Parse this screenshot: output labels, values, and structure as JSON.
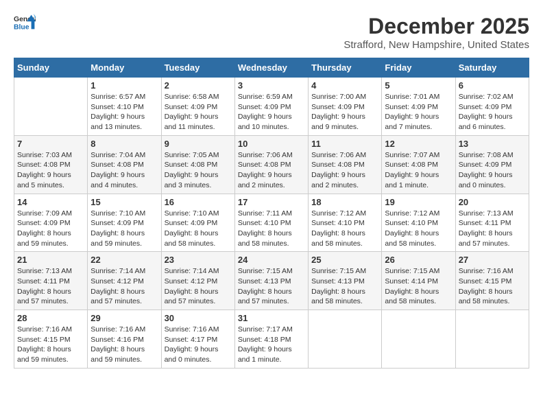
{
  "logo": {
    "line1": "General",
    "line2": "Blue"
  },
  "title": "December 2025",
  "location": "Strafford, New Hampshire, United States",
  "days_of_week": [
    "Sunday",
    "Monday",
    "Tuesday",
    "Wednesday",
    "Thursday",
    "Friday",
    "Saturday"
  ],
  "weeks": [
    [
      {
        "day": "",
        "info": ""
      },
      {
        "day": "1",
        "info": "Sunrise: 6:57 AM\nSunset: 4:10 PM\nDaylight: 9 hours\nand 13 minutes."
      },
      {
        "day": "2",
        "info": "Sunrise: 6:58 AM\nSunset: 4:09 PM\nDaylight: 9 hours\nand 11 minutes."
      },
      {
        "day": "3",
        "info": "Sunrise: 6:59 AM\nSunset: 4:09 PM\nDaylight: 9 hours\nand 10 minutes."
      },
      {
        "day": "4",
        "info": "Sunrise: 7:00 AM\nSunset: 4:09 PM\nDaylight: 9 hours\nand 9 minutes."
      },
      {
        "day": "5",
        "info": "Sunrise: 7:01 AM\nSunset: 4:09 PM\nDaylight: 9 hours\nand 7 minutes."
      },
      {
        "day": "6",
        "info": "Sunrise: 7:02 AM\nSunset: 4:09 PM\nDaylight: 9 hours\nand 6 minutes."
      }
    ],
    [
      {
        "day": "7",
        "info": "Sunrise: 7:03 AM\nSunset: 4:08 PM\nDaylight: 9 hours\nand 5 minutes."
      },
      {
        "day": "8",
        "info": "Sunrise: 7:04 AM\nSunset: 4:08 PM\nDaylight: 9 hours\nand 4 minutes."
      },
      {
        "day": "9",
        "info": "Sunrise: 7:05 AM\nSunset: 4:08 PM\nDaylight: 9 hours\nand 3 minutes."
      },
      {
        "day": "10",
        "info": "Sunrise: 7:06 AM\nSunset: 4:08 PM\nDaylight: 9 hours\nand 2 minutes."
      },
      {
        "day": "11",
        "info": "Sunrise: 7:06 AM\nSunset: 4:08 PM\nDaylight: 9 hours\nand 2 minutes."
      },
      {
        "day": "12",
        "info": "Sunrise: 7:07 AM\nSunset: 4:08 PM\nDaylight: 9 hours\nand 1 minute."
      },
      {
        "day": "13",
        "info": "Sunrise: 7:08 AM\nSunset: 4:09 PM\nDaylight: 9 hours\nand 0 minutes."
      }
    ],
    [
      {
        "day": "14",
        "info": "Sunrise: 7:09 AM\nSunset: 4:09 PM\nDaylight: 8 hours\nand 59 minutes."
      },
      {
        "day": "15",
        "info": "Sunrise: 7:10 AM\nSunset: 4:09 PM\nDaylight: 8 hours\nand 59 minutes."
      },
      {
        "day": "16",
        "info": "Sunrise: 7:10 AM\nSunset: 4:09 PM\nDaylight: 8 hours\nand 58 minutes."
      },
      {
        "day": "17",
        "info": "Sunrise: 7:11 AM\nSunset: 4:10 PM\nDaylight: 8 hours\nand 58 minutes."
      },
      {
        "day": "18",
        "info": "Sunrise: 7:12 AM\nSunset: 4:10 PM\nDaylight: 8 hours\nand 58 minutes."
      },
      {
        "day": "19",
        "info": "Sunrise: 7:12 AM\nSunset: 4:10 PM\nDaylight: 8 hours\nand 58 minutes."
      },
      {
        "day": "20",
        "info": "Sunrise: 7:13 AM\nSunset: 4:11 PM\nDaylight: 8 hours\nand 57 minutes."
      }
    ],
    [
      {
        "day": "21",
        "info": "Sunrise: 7:13 AM\nSunset: 4:11 PM\nDaylight: 8 hours\nand 57 minutes."
      },
      {
        "day": "22",
        "info": "Sunrise: 7:14 AM\nSunset: 4:12 PM\nDaylight: 8 hours\nand 57 minutes."
      },
      {
        "day": "23",
        "info": "Sunrise: 7:14 AM\nSunset: 4:12 PM\nDaylight: 8 hours\nand 57 minutes."
      },
      {
        "day": "24",
        "info": "Sunrise: 7:15 AM\nSunset: 4:13 PM\nDaylight: 8 hours\nand 57 minutes."
      },
      {
        "day": "25",
        "info": "Sunrise: 7:15 AM\nSunset: 4:13 PM\nDaylight: 8 hours\nand 58 minutes."
      },
      {
        "day": "26",
        "info": "Sunrise: 7:15 AM\nSunset: 4:14 PM\nDaylight: 8 hours\nand 58 minutes."
      },
      {
        "day": "27",
        "info": "Sunrise: 7:16 AM\nSunset: 4:15 PM\nDaylight: 8 hours\nand 58 minutes."
      }
    ],
    [
      {
        "day": "28",
        "info": "Sunrise: 7:16 AM\nSunset: 4:15 PM\nDaylight: 8 hours\nand 59 minutes."
      },
      {
        "day": "29",
        "info": "Sunrise: 7:16 AM\nSunset: 4:16 PM\nDaylight: 8 hours\nand 59 minutes."
      },
      {
        "day": "30",
        "info": "Sunrise: 7:16 AM\nSunset: 4:17 PM\nDaylight: 9 hours\nand 0 minutes."
      },
      {
        "day": "31",
        "info": "Sunrise: 7:17 AM\nSunset: 4:18 PM\nDaylight: 9 hours\nand 1 minute."
      },
      {
        "day": "",
        "info": ""
      },
      {
        "day": "",
        "info": ""
      },
      {
        "day": "",
        "info": ""
      }
    ]
  ]
}
